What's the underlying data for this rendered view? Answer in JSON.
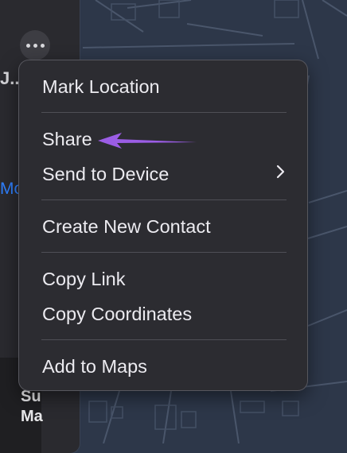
{
  "sidebar": {
    "more_icon": "ellipsis-icon",
    "partial_texts": [
      "J..",
      "Mo",
      "Su",
      "Ma"
    ]
  },
  "menu": {
    "items": [
      {
        "label": "Mark Location"
      },
      {
        "label": "Share"
      },
      {
        "label": "Send to Device",
        "submenu": true
      },
      {
        "label": "Create New Contact"
      },
      {
        "label": "Copy Link"
      },
      {
        "label": "Copy Coordinates"
      },
      {
        "label": "Add to Maps"
      }
    ]
  },
  "annotation": {
    "type": "arrow",
    "color": "#9b5de5",
    "points_to": "Share"
  },
  "colors": {
    "map_bg": "#2d3749",
    "menu_bg": "#2c2c31",
    "link": "#2f80ff"
  }
}
